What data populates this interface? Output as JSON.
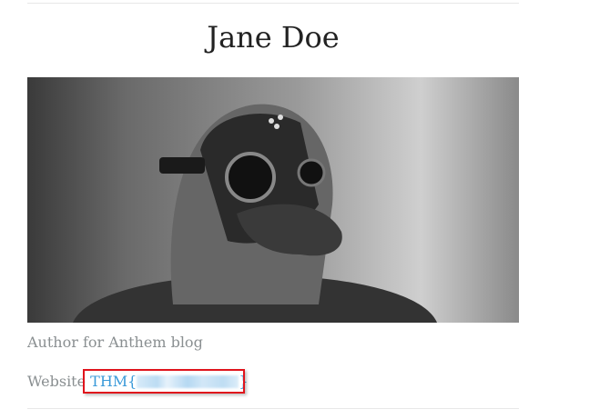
{
  "author": {
    "name": "Jane Doe",
    "bio": "Author for Anthem blog",
    "website_label": "Website",
    "website_prefix": "THM{",
    "website_suffix": "}"
  },
  "photo": {
    "alt": "person wearing plague doctor mask",
    "style": "black-and-white"
  },
  "colors": {
    "link": "#3a9ad9",
    "highlight_box": "#e0141c",
    "muted_text": "#8a8f91"
  }
}
